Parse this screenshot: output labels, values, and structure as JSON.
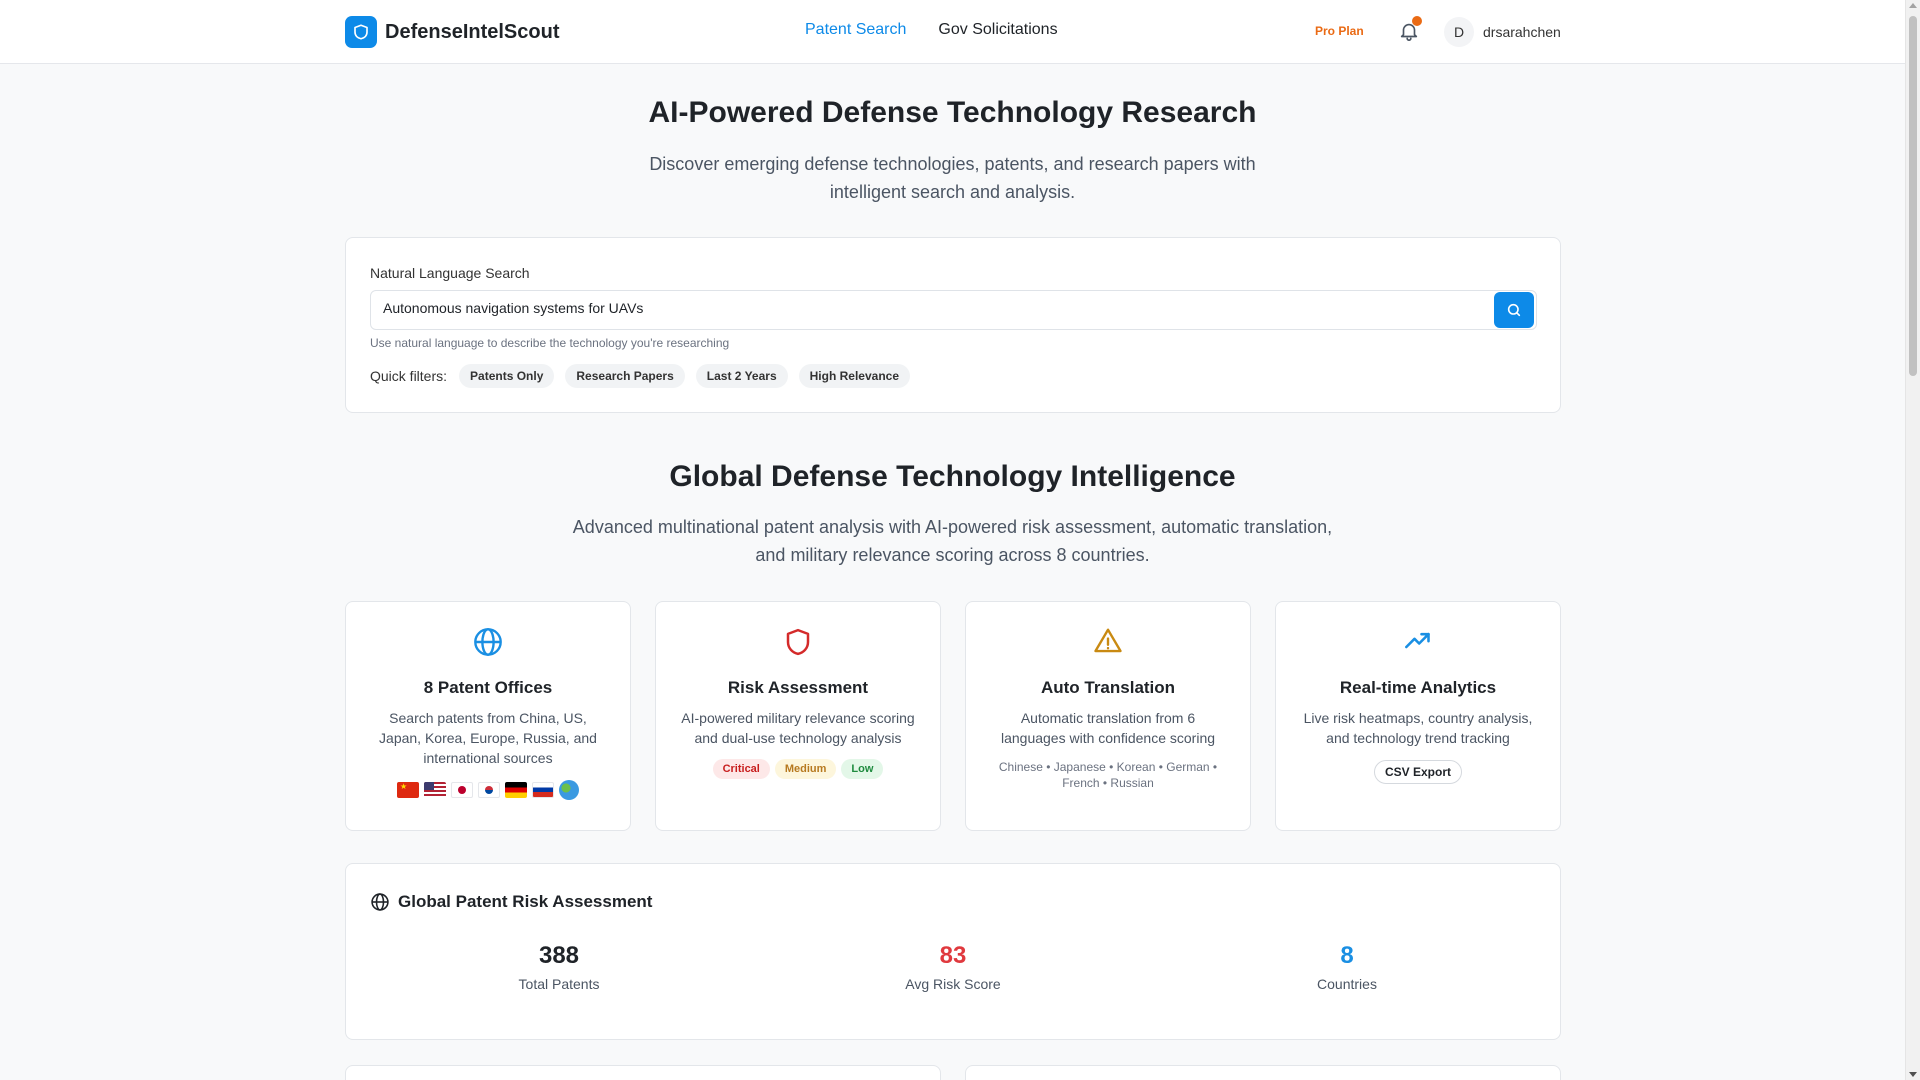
{
  "header": {
    "brand": "DefenseIntelScout",
    "nav": [
      "Patent Search",
      "Gov Solicitations"
    ],
    "plan": "Pro Plan",
    "avatar_initial": "D",
    "username": "drsarahchen"
  },
  "hero": {
    "title": "AI-Powered Defense Technology Research",
    "subtitle": "Discover emerging defense technologies, patents, and research papers with intelligent search and analysis."
  },
  "search": {
    "label": "Natural Language Search",
    "value": "Autonomous navigation systems for UAVs",
    "hint": "Use natural language to describe the technology you're researching",
    "filters_label": "Quick filters:",
    "filters": [
      "Patents Only",
      "Research Papers",
      "Last 2 Years",
      "High Relevance"
    ]
  },
  "intel": {
    "title": "Global Defense Technology Intelligence",
    "subtitle": "Advanced multinational patent analysis with AI-powered risk assessment, automatic translation, and military relevance scoring across 8 countries."
  },
  "features": [
    {
      "title": "8 Patent Offices",
      "desc": "Search patents from China, US, Japan, Korea, Europe, Russia, and international sources",
      "icon": "globe-icon"
    },
    {
      "title": "Risk Assessment",
      "desc": "AI-powered military relevance scoring and dual-use technology analysis",
      "icon": "shield-icon",
      "tags": [
        "Critical",
        "Medium",
        "Low"
      ]
    },
    {
      "title": "Auto Translation",
      "desc": "Automatic translation from 6 languages with confidence scoring",
      "icon": "warning-icon",
      "languages": "Chinese • Japanese • Korean • German • French • Russian"
    },
    {
      "title": "Real-time Analytics",
      "desc": "Live risk heatmaps, country analysis, and technology trend tracking",
      "icon": "trending-up-icon",
      "badge": "CSV Export"
    }
  ],
  "stats": {
    "title": "Global Patent Risk Assessment",
    "items": [
      {
        "value": "388",
        "label": "Total Patents",
        "color": "#1f2328"
      },
      {
        "value": "83",
        "label": "Avg Risk Score",
        "color": "#e0393e"
      },
      {
        "value": "8",
        "label": "Countries",
        "color": "#1a8fe3"
      }
    ]
  },
  "colors": {
    "accent": "#0d8ae8",
    "orange": "#ea6a14",
    "critical": "#c81e1e",
    "medium": "#b7791f",
    "low": "#1f8b3f"
  }
}
